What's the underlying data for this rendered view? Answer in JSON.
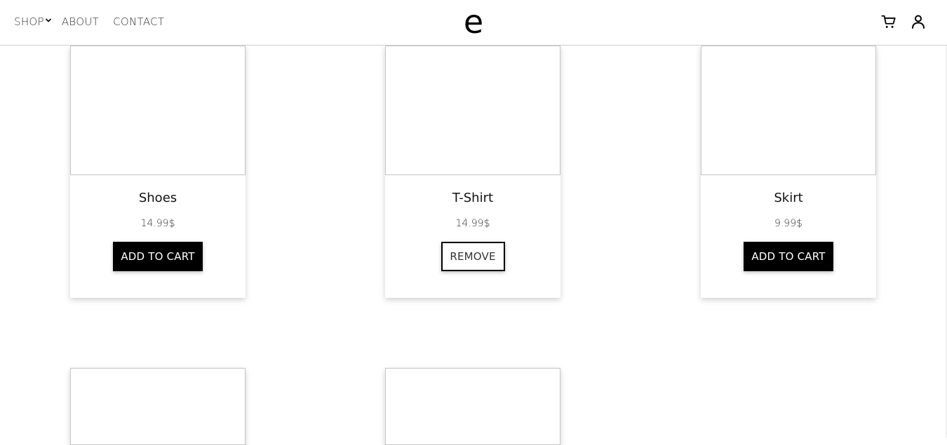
{
  "nav": {
    "shop_label": "SHOP",
    "about_label": "ABOUT",
    "contact_label": "CONTACT"
  },
  "brand": {
    "logo_text": "e"
  },
  "icons": {
    "cart": "cart-icon",
    "user": "user-icon",
    "chevron": "chevron-down-icon"
  },
  "products": [
    {
      "title": "Shoes",
      "price": "14.99$",
      "action_label": "ADD TO CART",
      "in_cart": false
    },
    {
      "title": "T-Shirt",
      "price": "14.99$",
      "action_label": "REMOVE",
      "in_cart": true
    },
    {
      "title": "Skirt",
      "price": "9.99$",
      "action_label": "ADD TO CART",
      "in_cart": false
    }
  ],
  "colors": {
    "primary": "#000000",
    "background": "#ffffff",
    "border": "#c6c6c6"
  }
}
